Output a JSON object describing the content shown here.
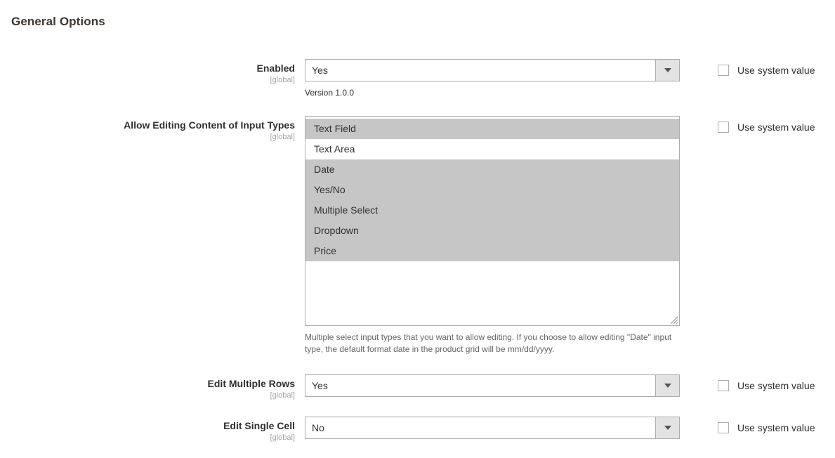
{
  "section": {
    "title": "General Options"
  },
  "scope_tag": "[global]",
  "use_system_value_label": "Use system value",
  "fields": [
    {
      "label": "Enabled",
      "scope": "[global]",
      "type": "select",
      "value": "Yes",
      "note": "Version 1.0.0",
      "use_system_value": false
    },
    {
      "label": "Allow Editing Content of Input Types",
      "scope": "[global]",
      "type": "multiselect",
      "note": "Multiple select input types that you want to allow editing. If you choose to allow editing \"Date\" input type, the default format date in the product grid will be mm/dd/yyyy.",
      "use_system_value": false,
      "options": [
        {
          "label": "Text Field",
          "selected": true
        },
        {
          "label": "Text Area",
          "selected": false
        },
        {
          "label": "Date",
          "selected": true
        },
        {
          "label": "Yes/No",
          "selected": true
        },
        {
          "label": "Multiple Select",
          "selected": true
        },
        {
          "label": "Dropdown",
          "selected": true
        },
        {
          "label": "Price",
          "selected": true
        }
      ]
    },
    {
      "label": "Edit Multiple Rows",
      "scope": "[global]",
      "type": "select",
      "value": "Yes",
      "use_system_value": false
    },
    {
      "label": "Edit Single Cell",
      "scope": "[global]",
      "type": "select",
      "value": "No",
      "use_system_value": false
    }
  ],
  "colors": {
    "text": "#303030",
    "heading": "#41362f",
    "scope": "#a6a6a6",
    "border": "#adadad",
    "selected_option_bg": "#c6c6c6",
    "arrow_button_bg": "#e3e3e3"
  }
}
